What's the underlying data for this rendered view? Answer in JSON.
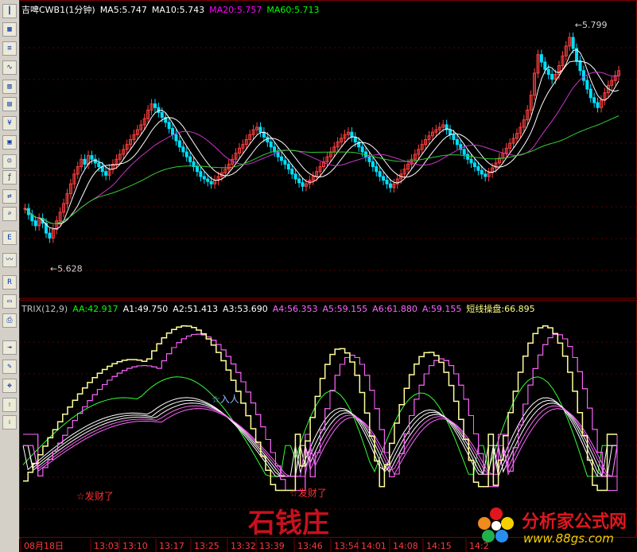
{
  "upper": {
    "legend": [
      {
        "text": "吉啤CWB1(1分钟)",
        "color": "#ffffff"
      },
      {
        "text": "MA5:5.747",
        "color": "#ffffff"
      },
      {
        "text": "MA10:5.743",
        "color": "#ffffff"
      },
      {
        "text": "MA20:5.757",
        "color": "#ff00ff"
      },
      {
        "text": "MA60:5.713",
        "color": "#00ff00"
      }
    ],
    "high_label": "5.799",
    "low_label": "5.628"
  },
  "lower": {
    "legend": [
      {
        "text": "TRIX(12,9)",
        "color": "#c0c0c0"
      },
      {
        "text": "AA:42.917",
        "color": "#00ff00"
      },
      {
        "text": "A1:49.750",
        "color": "#ffffff"
      },
      {
        "text": "A2:51.413",
        "color": "#ffffff"
      },
      {
        "text": "A3:53.690",
        "color": "#ffffff"
      },
      {
        "text": "A4:56.353",
        "color": "#ff66ff"
      },
      {
        "text": "A5:59.155",
        "color": "#ff66ff"
      },
      {
        "text": "A6:61.880",
        "color": "#ff66ff"
      },
      {
        "text": "A:59.155",
        "color": "#ff66ff"
      },
      {
        "text": "短线操盘:66.895",
        "color": "#ffff80"
      }
    ],
    "annotations": {
      "buy1": "发财了",
      "buy2": "发财了",
      "enter": "入人"
    }
  },
  "time_axis": [
    "08月18日",
    "13:03",
    "13:10",
    "13:17",
    "13:25",
    "13:32",
    "13:39",
    "13:46",
    "13:54",
    "14:01",
    "14:08",
    "14:15",
    "14:2"
  ],
  "watermarks": {
    "logo": "石钱庄",
    "site_cn": "分析家公式网",
    "site_url": "www.88gs.com"
  },
  "toolbar_icons": [
    "candle-icon",
    "table-icon",
    "list-icon",
    "line-chart-icon",
    "bar-chart-icon",
    "grid-icon",
    "quote-icon",
    "calendar-icon",
    "user-group-icon",
    "formula-icon",
    "compare-icon",
    "search-icon",
    "etf-icon",
    "wave-icon",
    "rsi-icon",
    "window-icon",
    "print-icon",
    "import-icon",
    "pencil-icon",
    "move-icon",
    "up-arrow-icon",
    "down-arrow-icon"
  ],
  "chart_data": [
    {
      "type": "candlestick",
      "title": "吉啤CWB1(1分钟)",
      "ylim": [
        5.6,
        5.81
      ],
      "xlabel": "",
      "ylabel": "",
      "series_names": [
        "MA5",
        "MA10",
        "MA20",
        "MA60"
      ],
      "series_colors": {
        "MA5": "#ffffff",
        "MA10": "#ffffff",
        "MA20": "#cc33cc",
        "MA60": "#33cc33"
      },
      "closes": [
        5.66,
        5.655,
        5.65,
        5.646,
        5.652,
        5.648,
        5.64,
        5.636,
        5.643,
        5.65,
        5.657,
        5.664,
        5.672,
        5.68,
        5.688,
        5.694,
        5.7,
        5.696,
        5.703,
        5.7,
        5.697,
        5.694,
        5.69,
        5.687,
        5.692,
        5.696,
        5.7,
        5.704,
        5.708,
        5.712,
        5.716,
        5.72,
        5.724,
        5.728,
        5.733,
        5.74,
        5.745,
        5.742,
        5.738,
        5.734,
        5.73,
        5.725,
        5.72,
        5.715,
        5.71,
        5.706,
        5.702,
        5.698,
        5.694,
        5.69,
        5.686,
        5.684,
        5.682,
        5.68,
        5.683,
        5.686,
        5.689,
        5.692,
        5.696,
        5.7,
        5.705,
        5.709,
        5.712,
        5.716,
        5.72,
        5.724,
        5.726,
        5.722,
        5.718,
        5.714,
        5.71,
        5.706,
        5.702,
        5.699,
        5.696,
        5.692,
        5.688,
        5.684,
        5.681,
        5.678,
        5.68,
        5.683,
        5.686,
        5.69,
        5.694,
        5.698,
        5.702,
        5.706,
        5.71,
        5.714,
        5.717,
        5.72,
        5.722,
        5.718,
        5.714,
        5.71,
        5.706,
        5.702,
        5.698,
        5.694,
        5.69,
        5.686,
        5.683,
        5.68,
        5.677,
        5.68,
        5.684,
        5.688,
        5.692,
        5.696,
        5.7,
        5.704,
        5.708,
        5.712,
        5.716,
        5.719,
        5.722,
        5.724,
        5.726,
        5.728,
        5.724,
        5.72,
        5.716,
        5.712,
        5.708,
        5.704,
        5.7,
        5.697,
        5.694,
        5.691,
        5.688,
        5.686,
        5.689,
        5.693,
        5.697,
        5.701,
        5.705,
        5.709,
        5.713,
        5.717,
        5.721,
        5.726,
        5.732,
        5.74,
        5.752,
        5.77,
        5.785,
        5.779,
        5.773,
        5.769,
        5.765,
        5.769,
        5.776,
        5.784,
        5.792,
        5.799,
        5.79,
        5.78,
        5.772,
        5.764,
        5.757,
        5.75,
        5.746,
        5.742,
        5.748,
        5.754,
        5.76,
        5.764,
        5.768,
        5.772
      ]
    },
    {
      "type": "line",
      "title": "TRIX(12,9)",
      "xlabel": "",
      "ylabel": "",
      "series": [
        {
          "name": "AA",
          "last": 42.917,
          "color": "#33ff33"
        },
        {
          "name": "A1",
          "last": 49.75,
          "color": "#ffffff"
        },
        {
          "name": "A2",
          "last": 51.413,
          "color": "#ffffff"
        },
        {
          "name": "A3",
          "last": 53.69,
          "color": "#ffffff"
        },
        {
          "name": "A4",
          "last": 56.353,
          "color": "#ff66ff"
        },
        {
          "name": "A5",
          "last": 59.155,
          "color": "#ff66ff"
        },
        {
          "name": "A6",
          "last": 61.88,
          "color": "#ff66ff"
        },
        {
          "name": "A",
          "last": 59.155,
          "color": "#ff66ff"
        },
        {
          "name": "短线操盘",
          "last": 66.895,
          "color": "#ffff99"
        }
      ],
      "cycles": [
        {
          "start": 0.0,
          "peak": 0.22,
          "trough": 0.36,
          "top": 80,
          "bottom": 15
        },
        {
          "start": 0.12,
          "peak": 0.28,
          "trough": 0.42,
          "top": 98,
          "bottom": 10
        },
        {
          "start": 0.46,
          "peak": 0.56,
          "trough": 0.6,
          "top": 86,
          "bottom": 12
        },
        {
          "start": 0.6,
          "peak": 0.7,
          "trough": 0.76,
          "top": 84,
          "bottom": 12
        },
        {
          "start": 0.79,
          "peak": 0.9,
          "trough": 0.96,
          "top": 98,
          "bottom": 10
        }
      ],
      "ylim": [
        0,
        100
      ]
    }
  ]
}
